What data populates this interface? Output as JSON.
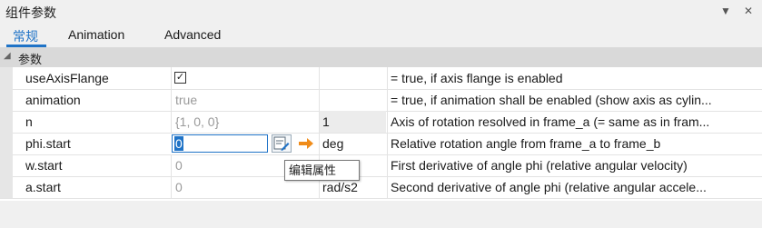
{
  "panel": {
    "title": "组件参数",
    "dropdown_icon": "triangle-down-icon",
    "close_icon": "close-icon"
  },
  "tabs": [
    {
      "label": "常规",
      "active": true
    },
    {
      "label": "Animation",
      "active": false
    },
    {
      "label": "Advanced",
      "active": false
    }
  ],
  "group": {
    "label": "参数",
    "collapse_icon": "collapse-triangle-icon"
  },
  "rows": [
    {
      "name": "useAxisFlange",
      "value": "",
      "checked": true,
      "unit": "",
      "desc": "= true, if axis flange is enabled"
    },
    {
      "name": "animation",
      "value": "true",
      "unit": "",
      "desc": "= true, if animation shall be enabled (show axis as cylin..."
    },
    {
      "name": "n",
      "value": "{1, 0, 0}",
      "unit": "1",
      "desc": "Axis of rotation resolved in frame_a (= same as in fram..."
    },
    {
      "name": "phi.start",
      "value": "0",
      "unit": "deg",
      "desc": "Relative rotation angle from frame_a to frame_b"
    },
    {
      "name": "w.start",
      "value": "0",
      "unit": "rad/s",
      "desc": "First derivative of angle phi (relative angular velocity)"
    },
    {
      "name": "a.start",
      "value": "0",
      "unit": "rad/s2",
      "desc": "Second derivative of angle phi (relative angular accele..."
    }
  ],
  "editor": {
    "edit_icon": "edit-attributes-icon",
    "arrow_icon": "orange-arrow-icon"
  },
  "tooltip": {
    "text": "编辑属性"
  },
  "colors": {
    "accent": "#1f73c7",
    "arrow": "#f08c1a"
  }
}
